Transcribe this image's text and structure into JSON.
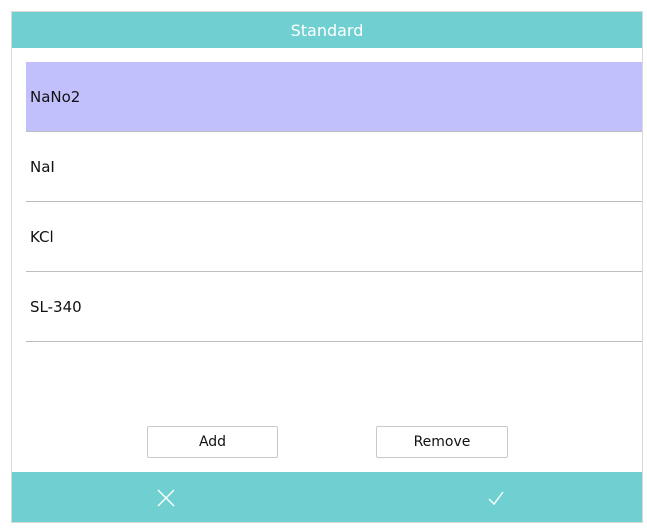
{
  "dialog": {
    "title": "Standard"
  },
  "standards": [
    {
      "label": "NaNo2",
      "selected": true
    },
    {
      "label": "NaI",
      "selected": false
    },
    {
      "label": "KCl",
      "selected": false
    },
    {
      "label": "SL-340",
      "selected": false
    }
  ],
  "buttons": {
    "add_label": "Add",
    "remove_label": "Remove"
  },
  "footer": {
    "cancel_icon": "close-icon",
    "confirm_icon": "check-icon"
  },
  "colors": {
    "accent": "#6fcfd1",
    "selected_row": "#c1c0fc"
  }
}
